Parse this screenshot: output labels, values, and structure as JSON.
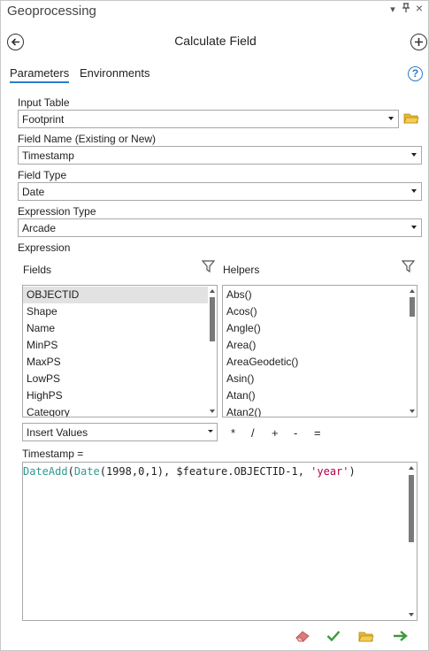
{
  "pane": {
    "title": "Geoprocessing",
    "controls": {
      "menu": "▾",
      "pin": "⊥",
      "close": "×"
    }
  },
  "tool": {
    "title": "Calculate Field"
  },
  "tabs": [
    {
      "label": "Parameters",
      "active": true
    },
    {
      "label": "Environments",
      "active": false
    }
  ],
  "help_label": "?",
  "params": {
    "input_table": {
      "label": "Input Table",
      "value": "Footprint"
    },
    "field_name": {
      "label": "Field Name (Existing or New)",
      "value": "Timestamp"
    },
    "field_type": {
      "label": "Field Type",
      "value": "Date"
    },
    "expression_type": {
      "label": "Expression Type",
      "value": "Arcade"
    }
  },
  "expression": {
    "label": "Expression",
    "fields_label": "Fields",
    "helpers_label": "Helpers",
    "fields": [
      "OBJECTID",
      "Shape",
      "Name",
      "MinPS",
      "MaxPS",
      "LowPS",
      "HighPS",
      "Category"
    ],
    "selected_field": "OBJECTID",
    "helpers": [
      "Abs()",
      "Acos()",
      "Angle()",
      "Area()",
      "AreaGeodetic()",
      "Asin()",
      "Atan()",
      "Atan2()"
    ],
    "insert_values": "Insert Values",
    "operators": [
      "*",
      "/",
      "+",
      "-",
      "="
    ],
    "target_label": "Timestamp =",
    "code": {
      "fn1": "DateAdd",
      "p1": "(",
      "fn2": "Date",
      "args": "(1998,0,1), ",
      "var": "$feature.OBJECTID-1, ",
      "str": "'year'",
      "close": ")"
    }
  },
  "colors": {
    "accent": "#2c7bcb",
    "run_arrow": "#3c9a3c",
    "validate_check": "#3c9a3c",
    "folder": "#e8b830",
    "eraser": "#e07a7a"
  },
  "icons": [
    "back-arrow-icon",
    "add-circle-icon",
    "help-icon",
    "folder-icon",
    "filter-icon",
    "eraser-icon",
    "check-icon",
    "run-arrow-icon"
  ]
}
